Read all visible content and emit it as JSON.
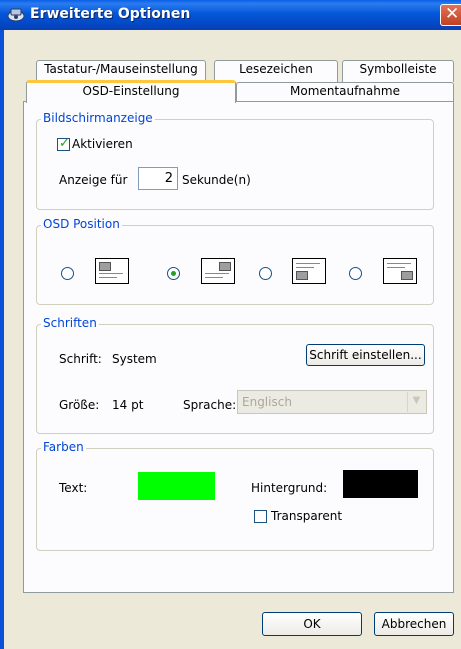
{
  "window": {
    "title": "Erweiterte Optionen"
  },
  "tabs": [
    "Tastatur-/Mauseinstellung",
    "Lesezeichen",
    "Symbolleiste",
    "OSD-Einstellung",
    "Momentaufnahme"
  ],
  "display": {
    "legend": "Bildschirmanzeige",
    "activate_label": "Aktivieren",
    "activate_checked": true,
    "show_for_label": "Anzeige für",
    "seconds_value": "2",
    "seconds_label": "Sekunde(n)"
  },
  "osd_position": {
    "legend": "OSD Position",
    "options": [
      "top-left",
      "top-right",
      "bottom-left",
      "bottom-right"
    ],
    "selected_index": 1
  },
  "fonts": {
    "legend": "Schriften",
    "font_label": "Schrift:",
    "font_value": "System",
    "set_font_button": "Schrift einstellen...",
    "size_label": "Größe:",
    "size_value": "14 pt",
    "language_label": "Sprache:",
    "language_value": "Englisch"
  },
  "colors": {
    "legend": "Farben",
    "text_label": "Text:",
    "text_color": "#00FF00",
    "background_label": "Hintergrund:",
    "background_color": "#000000",
    "transparent_label": "Transparent",
    "transparent_checked": false
  },
  "footer": {
    "ok": "OK",
    "cancel": "Abbrechen"
  }
}
